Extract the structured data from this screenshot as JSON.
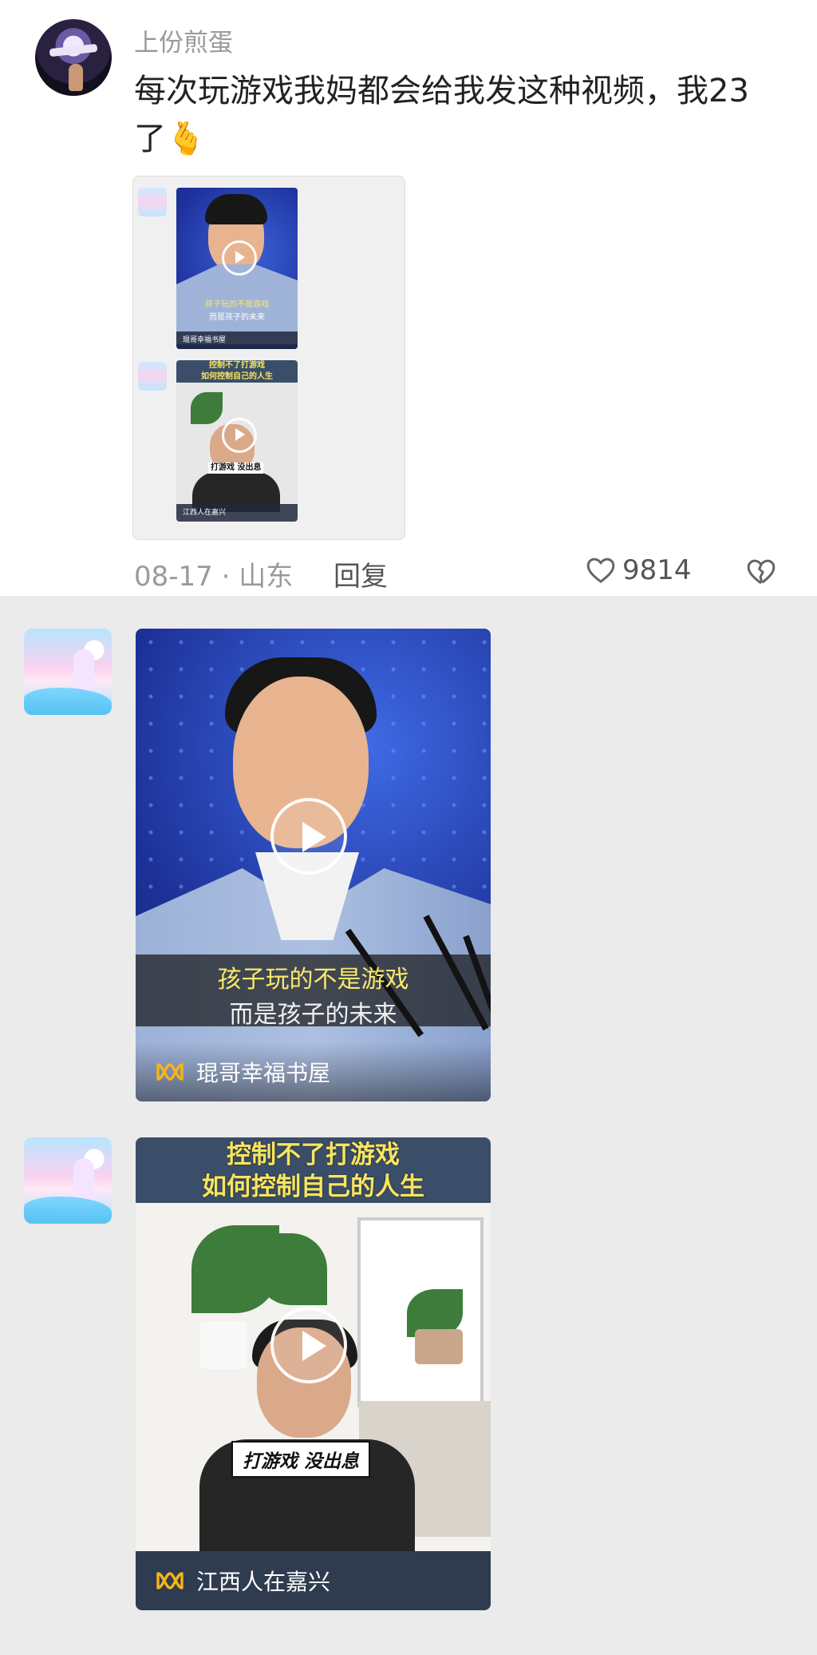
{
  "comment": {
    "username": "上份煎蛋",
    "text": "每次玩游戏我妈都会给我发这种视频，我23了",
    "emoji": "🫰",
    "time_location": "08-17 · 山东",
    "reply_label": "回复",
    "like_count": "9814"
  },
  "thumbnails": [
    {
      "caption_line1": "孩子玩的不是游戏",
      "caption_line2": "而是孩子的未来",
      "source": "琨哥幸福书屋"
    },
    {
      "caption_line1": "控制不了打游戏",
      "caption_line2": "如何控制自己的人生",
      "label": "打游戏  没出息",
      "source": "江西人在嘉兴"
    }
  ],
  "videos": [
    {
      "caption_line1": "孩子玩的不是游戏",
      "caption_line2": "而是孩子的未来",
      "source": "琨哥幸福书屋"
    },
    {
      "title_line1": "控制不了打游戏",
      "title_line2": "如何控制自己的人生",
      "label": "打游戏  没出息",
      "source": "江西人在嘉兴"
    }
  ],
  "colors": {
    "background": "#ebebeb",
    "caption_yellow": "#f8e96b",
    "blue_stage": "#1c3096"
  }
}
